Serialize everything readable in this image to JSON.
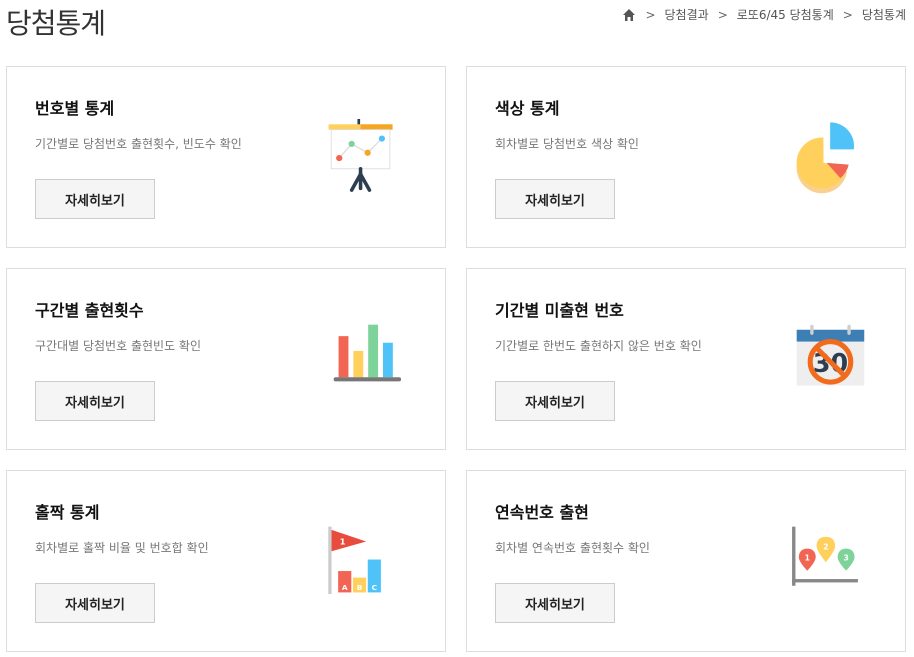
{
  "header": {
    "title": "당첨통계",
    "breadcrumb": [
      "당첨결과",
      "로또6/45 당첨통계",
      "당첨통계"
    ],
    "home_icon": "home-icon"
  },
  "cards": [
    {
      "title": "번호별 통계",
      "desc": "기간별로 당첨번호 출현횟수, 빈도수 확인",
      "button": "자세히보기",
      "icon": "presentation-chart-icon"
    },
    {
      "title": "색상 통계",
      "desc": "회차별로 당첨번호 색상 확인",
      "button": "자세히보기",
      "icon": "pie-chart-icon"
    },
    {
      "title": "구간별 출현횟수",
      "desc": "구간대별 당첨번호 출현빈도 확인",
      "button": "자세히보기",
      "icon": "bar-chart-icon"
    },
    {
      "title": "기간별 미출현 번호",
      "desc": "기간별로 한번도 출현하지 않은 번호 확인",
      "button": "자세히보기",
      "icon": "calendar-no-icon"
    },
    {
      "title": "홀짝 통계",
      "desc": "회차별로 홀짝 비율 및 번호합 확인",
      "button": "자세히보기",
      "icon": "flag-abc-icon"
    },
    {
      "title": "연속번호 출현",
      "desc": "회차별 연속번호 출현횟수 확인",
      "button": "자세히보기",
      "icon": "map-pins-chart-icon"
    }
  ],
  "illustrations": {
    "calendar_number": "30",
    "flag_number": "1",
    "blocks": [
      "A",
      "B",
      "C"
    ],
    "pins": [
      "1",
      "2",
      "3"
    ]
  },
  "colors": {
    "yellow": "#ffd05b",
    "orange": "#f5a623",
    "red": "#f16552",
    "green": "#7ed39a",
    "blue": "#4fc3f7",
    "navy": "#2c3e50",
    "calendar_blue": "#3d7fb5",
    "no_sign": "#f26a1b"
  }
}
